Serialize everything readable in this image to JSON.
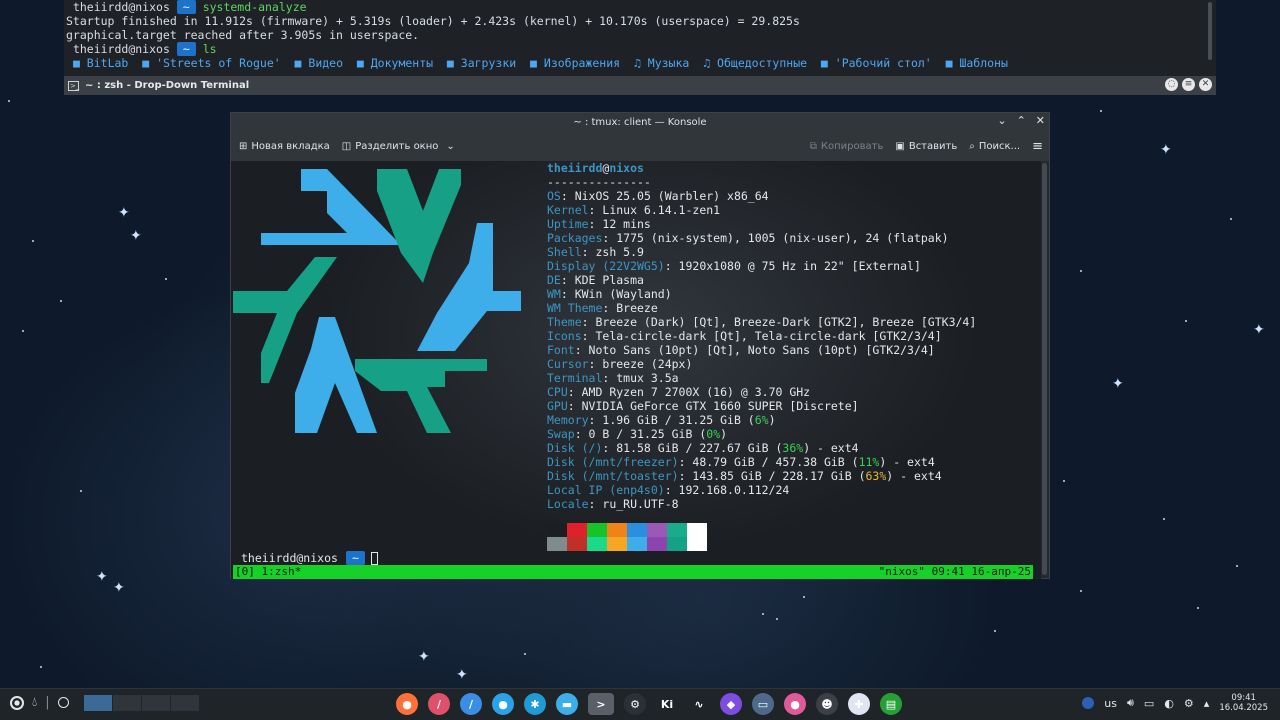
{
  "dropdown": {
    "line1_user": "theiirdd@nixos",
    "line1_dir": "~",
    "line1_cmd": "systemd-analyze",
    "line2": "Startup finished in 11.912s (firmware) + 5.319s (loader) + 2.423s (kernel) + 10.170s (userspace) = 29.825s",
    "line3": "graphical.target reached after 3.905s in userspace.",
    "line4_user": "theiirdd@nixos",
    "line4_dir": "~",
    "line4_cmd": "ls",
    "ls_items": [
      "BitLab",
      "'Streets of Rogue'",
      "Видео",
      "Документы",
      "Загрузки",
      "Изображения",
      "Музыка",
      "Общедоступные",
      "'Рабочий стол'",
      "Шаблоны"
    ],
    "title": "~ : zsh - Drop-Down Terminal"
  },
  "konsole": {
    "title": "~ : tmux: client — Konsole",
    "new_tab": "Новая вкладка",
    "split": "Разделить окно",
    "copy": "Копировать",
    "paste": "Вставить",
    "search": "Поиск..."
  },
  "fetch": {
    "user": "theiirdd",
    "at": "@",
    "host": "nixos",
    "separator": "---------------",
    "rows": [
      {
        "k": "OS",
        "v": ": NixOS 25.05 (Warbler) x86_64"
      },
      {
        "k": "Kernel",
        "v": ": Linux 6.14.1-zen1"
      },
      {
        "k": "Uptime",
        "v": ": 12 mins"
      },
      {
        "k": "Packages",
        "v": ": 1775 (nix-system), 1005 (nix-user), 24 (flatpak)"
      },
      {
        "k": "Shell",
        "v": ": zsh 5.9"
      },
      {
        "k": "Display (22V2WG5)",
        "v": ": 1920x1080 @ 75 Hz in 22\" [External]"
      },
      {
        "k": "DE",
        "v": ": KDE Plasma"
      },
      {
        "k": "WM",
        "v": ": KWin (Wayland)"
      },
      {
        "k": "WM Theme",
        "v": ": Breeze"
      },
      {
        "k": "Theme",
        "v": ": Breeze (Dark) [Qt], Breeze-Dark [GTK2], Breeze [GTK3/4]"
      },
      {
        "k": "Icons",
        "v": ": Tela-circle-dark [Qt], Tela-circle-dark [GTK2/3/4]"
      },
      {
        "k": "Font",
        "v": ": Noto Sans (10pt) [Qt], Noto Sans (10pt) [GTK2/3/4]"
      },
      {
        "k": "Cursor",
        "v": ": breeze (24px)"
      },
      {
        "k": "Terminal",
        "v": ": tmux 3.5a"
      },
      {
        "k": "CPU",
        "v": ": AMD Ryzen 7 2700X (16) @ 3.70 GHz"
      },
      {
        "k": "GPU",
        "v": ": NVIDIA GeForce GTX 1660 SUPER [Discrete]"
      }
    ],
    "memory": {
      "k": "Memory",
      "v": ": 1.96 GiB / 31.25 GiB (",
      "pct": "6%",
      "end": ")"
    },
    "swap": {
      "k": "Swap",
      "v": ": 0 B / 31.25 GiB (",
      "pct": "0%",
      "end": ")"
    },
    "disk1": {
      "k": "Disk (/)",
      "v": ": 81.58 GiB / 227.67 GiB (",
      "pct": "36%",
      "end": ") - ext4"
    },
    "disk2": {
      "k": "Disk (/mnt/freezer)",
      "v": ": 48.79 GiB / 457.38 GiB (",
      "pct": "11%",
      "end": ") - ext4"
    },
    "disk3": {
      "k": "Disk (/mnt/toaster)",
      "v": ": 143.85 GiB / 228.17 GiB (",
      "pct": "63%",
      "end": ") - ext4"
    },
    "ip": {
      "k": "Local IP (enp4s0)",
      "v": ": 192.168.0.112/24"
    },
    "locale": {
      "k": "Locale",
      "v": ": ru_RU.UTF-8"
    },
    "palette_top": [
      "#1b1e22",
      "#e0202a",
      "#16c42a",
      "#f0821a",
      "#2a8fe0",
      "#9b59b6",
      "#1aab8a",
      "#ffffff"
    ],
    "palette_bottom": [
      "#7f8c8d",
      "#c0302a",
      "#1bd98a",
      "#f5a623",
      "#3daee9",
      "#8e44ad",
      "#16a085",
      "#ffffff"
    ],
    "logo_colors": {
      "blue": "#3daee9",
      "green": "#16a085"
    }
  },
  "prompt": {
    "user": "theiirdd@nixos",
    "dir": "~"
  },
  "tmux": {
    "left": "[0] 1:zsh*",
    "right": "\"nixos\" 09:41 16-апр-25"
  },
  "taskbar": {
    "apps": [
      {
        "name": "firefox-icon",
        "color": "#ff7139",
        "glyph": "●"
      },
      {
        "name": "pencil-app-icon",
        "color": "#e0506a",
        "glyph": "/"
      },
      {
        "name": "editor-app-icon",
        "color": "#3a8ee6",
        "glyph": "/"
      },
      {
        "name": "chat-app-icon",
        "color": "#2aa1e8",
        "glyph": "●"
      },
      {
        "name": "accessibility-app-icon",
        "color": "#1e9bd7",
        "glyph": "✱"
      },
      {
        "name": "files-app-icon",
        "color": "#3daee9",
        "glyph": "▬"
      },
      {
        "name": "terminal-app-icon",
        "color": "#5a6068",
        "glyph": ">"
      },
      {
        "name": "steam-app-icon",
        "color": "#2b2f36",
        "glyph": "⚙"
      },
      {
        "name": "krita-app-icon",
        "color": "#1f2429",
        "glyph": "Ki"
      },
      {
        "name": "graph-app-icon",
        "color": "#1f2429",
        "glyph": "∿"
      },
      {
        "name": "obsidian-app-icon",
        "color": "#7c4dde",
        "glyph": "◆"
      },
      {
        "name": "vm-app-icon",
        "color": "#4d6a8a",
        "glyph": "▭"
      },
      {
        "name": "color-app-icon",
        "color": "#e05a9a",
        "glyph": "●"
      },
      {
        "name": "bot-app-icon",
        "color": "#3b4046",
        "glyph": "☻"
      },
      {
        "name": "settings-app-icon",
        "color": "#dfe6f2",
        "glyph": "✚"
      },
      {
        "name": "monitor-app-icon",
        "color": "#25a035",
        "glyph": "▤"
      }
    ],
    "keyboard_layout": "us",
    "time": "09:41",
    "date": "16.04.2025"
  }
}
